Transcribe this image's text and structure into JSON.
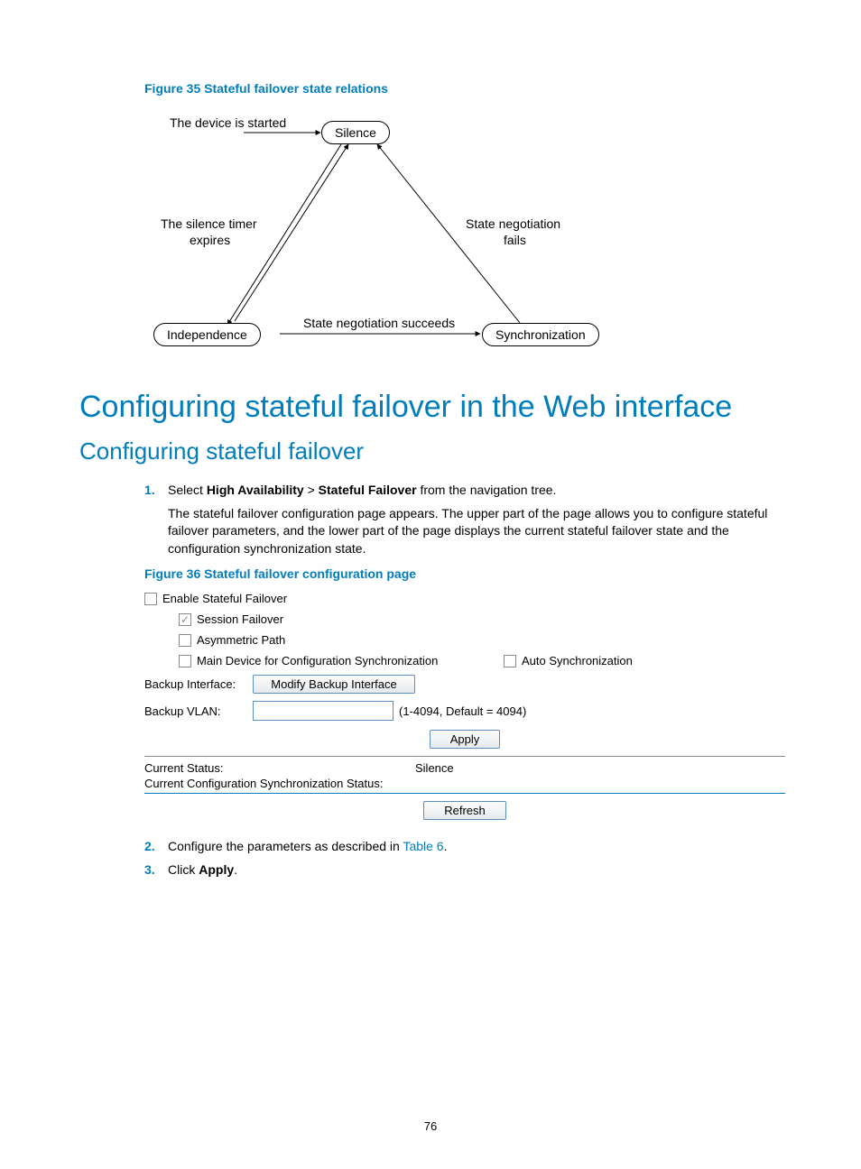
{
  "figure35": {
    "caption": "Figure 35 Stateful failover state relations",
    "nodes": {
      "silence": "Silence",
      "independence": "Independence",
      "sync": "Synchronization"
    },
    "edges": {
      "started": "The device is started",
      "timer1": "The silence timer",
      "timer2": "expires",
      "negfail1": "State negotiation",
      "negfail2": "fails",
      "negok": "State negotiation succeeds"
    }
  },
  "heading1": "Configuring stateful failover in the Web interface",
  "heading2": "Configuring stateful failover",
  "step1": {
    "num": "1.",
    "lead": "Select ",
    "ha": "High Availability",
    "gt": " > ",
    "sf": "Stateful Failover",
    "tail": " from the navigation tree.",
    "para": "The stateful failover configuration page appears. The upper part of the page allows you to configure stateful failover parameters, and the lower part of the page displays the current stateful failover state and the configuration synchronization state."
  },
  "figure36": {
    "caption": "Figure 36 Stateful failover configuration page",
    "opts": {
      "enable": "Enable Stateful Failover",
      "session": "Session Failover",
      "asym": "Asymmetric Path",
      "mainDevice": "Main Device for Configuration Synchronization",
      "autoSync": "Auto Synchronization"
    },
    "form": {
      "backupIfLabel": "Backup Interface:",
      "modifyBtn": "Modify Backup Interface",
      "backupVlanLabel": "Backup VLAN:",
      "vlanHint": "(1-4094, Default = 4094)",
      "applyBtn": "Apply"
    },
    "status": {
      "curStatusLabel": "Current Status:",
      "curStatusValue": "Silence",
      "syncStatusLabel": "Current Configuration Synchronization Status:",
      "syncStatusValue": "",
      "refreshBtn": "Refresh"
    }
  },
  "step2": {
    "num": "2.",
    "lead": "Configure the parameters as described in ",
    "link": "Table 6",
    "tail": "."
  },
  "step3": {
    "num": "3.",
    "lead": "Click ",
    "apply": "Apply",
    "tail": "."
  },
  "pageNumber": "76"
}
